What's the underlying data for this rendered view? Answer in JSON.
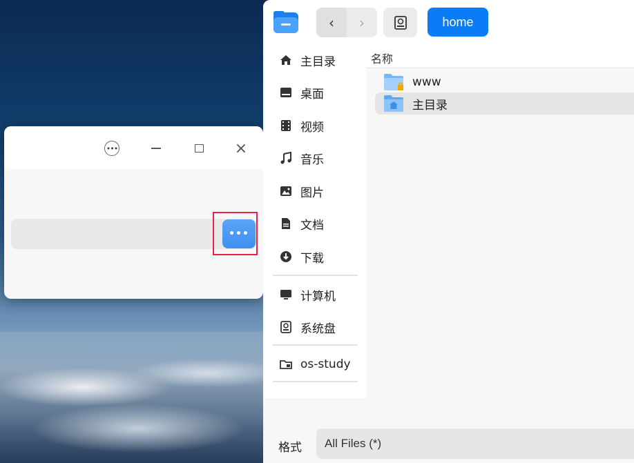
{
  "small_window": {
    "title_buttons": {
      "menu_icon": "menu-icon",
      "minimize_icon": "minimize-icon",
      "maximize_icon": "maximize-icon",
      "close_icon": "close-icon"
    },
    "browse_button_label": "•••",
    "path_value": ""
  },
  "file_dialog": {
    "toolbar": {
      "back_icon": "‹",
      "forward_icon": "›",
      "breadcrumb": "home"
    },
    "sidebar": {
      "items": [
        {
          "label": "主目录",
          "icon": "home-icon"
        },
        {
          "label": "桌面",
          "icon": "desktop-icon"
        },
        {
          "label": "视频",
          "icon": "video-icon"
        },
        {
          "label": "音乐",
          "icon": "music-icon"
        },
        {
          "label": "图片",
          "icon": "picture-icon"
        },
        {
          "label": "文档",
          "icon": "document-icon"
        },
        {
          "label": "下载",
          "icon": "download-icon"
        },
        {
          "label": "计算机",
          "icon": "computer-icon"
        },
        {
          "label": "系统盘",
          "icon": "disk-icon"
        },
        {
          "label": "os-study",
          "icon": "folder-icon"
        }
      ]
    },
    "column_header": "名称",
    "files": [
      {
        "name": "www",
        "icon": "locked-folder-icon",
        "selected": false
      },
      {
        "name": "主目录",
        "icon": "home-folder-icon",
        "selected": true
      }
    ],
    "format_label": "格式",
    "format_value": "All Files (*)"
  },
  "colors": {
    "accent": "#0a7cf5",
    "highlight": "#e8204a"
  }
}
